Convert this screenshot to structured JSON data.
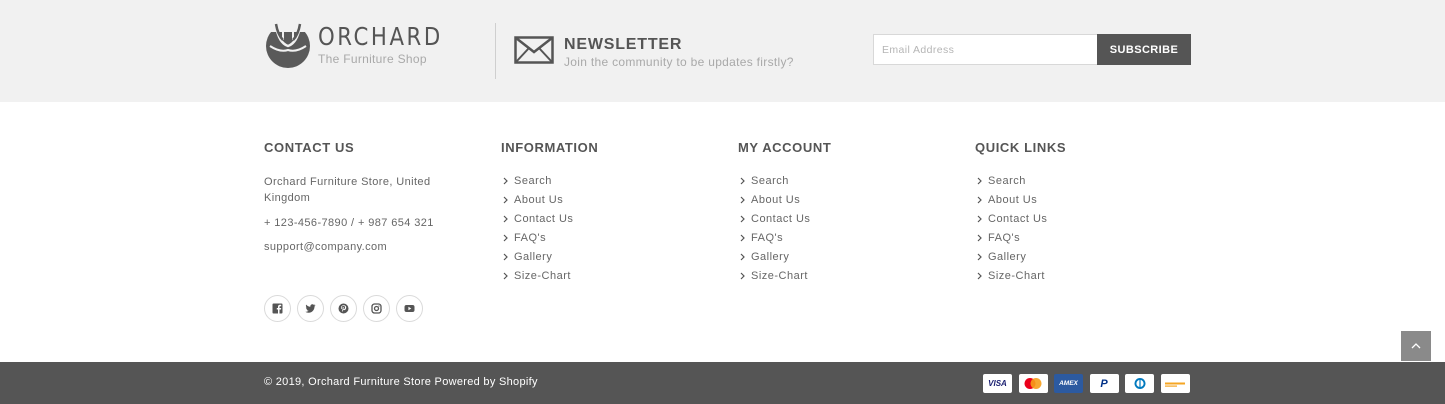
{
  "brand": {
    "name": "ORCHARD",
    "tagline": "The Furniture Shop"
  },
  "newsletter": {
    "title": "NEWSLETTER",
    "subtitle": "Join the community to be updates firstly?",
    "email_placeholder": "Email Address",
    "subscribe_label": "SUBSCRIBE"
  },
  "contact": {
    "title": "CONTACT US",
    "address": "Orchard Furniture Store, United Kingdom",
    "phone": "+ 123-456-7890 / + 987 654 321",
    "email": "support@company.com"
  },
  "information": {
    "title": "INFORMATION",
    "links": [
      "Search",
      "About Us",
      "Contact Us",
      "FAQ's",
      "Gallery",
      "Size-Chart"
    ]
  },
  "my_account": {
    "title": "MY ACCOUNT",
    "links": [
      "Search",
      "About Us",
      "Contact Us",
      "FAQ's",
      "Gallery",
      "Size-Chart"
    ]
  },
  "quick_links": {
    "title": "QUICK LINKS",
    "links": [
      "Search",
      "About Us",
      "Contact Us",
      "FAQ's",
      "Gallery",
      "Size-Chart"
    ]
  },
  "socials": [
    "facebook-icon",
    "twitter-icon",
    "pinterest-icon",
    "instagram-icon",
    "youtube-icon"
  ],
  "footer": {
    "copyright": "© 2019, Orchard Furniture Store Powered by Shopify"
  },
  "payments": {
    "visa": "VISA",
    "mastercard": "mastercard-icon",
    "amex": "AMEX",
    "paypal": "P",
    "diners": "diners-club-icon",
    "other": "card-icon"
  },
  "colors": {
    "top_band": "#f1f1f1",
    "bottom_bar": "#555555",
    "button": "#555555",
    "text": "#555555",
    "muted": "#a9a9a9"
  }
}
